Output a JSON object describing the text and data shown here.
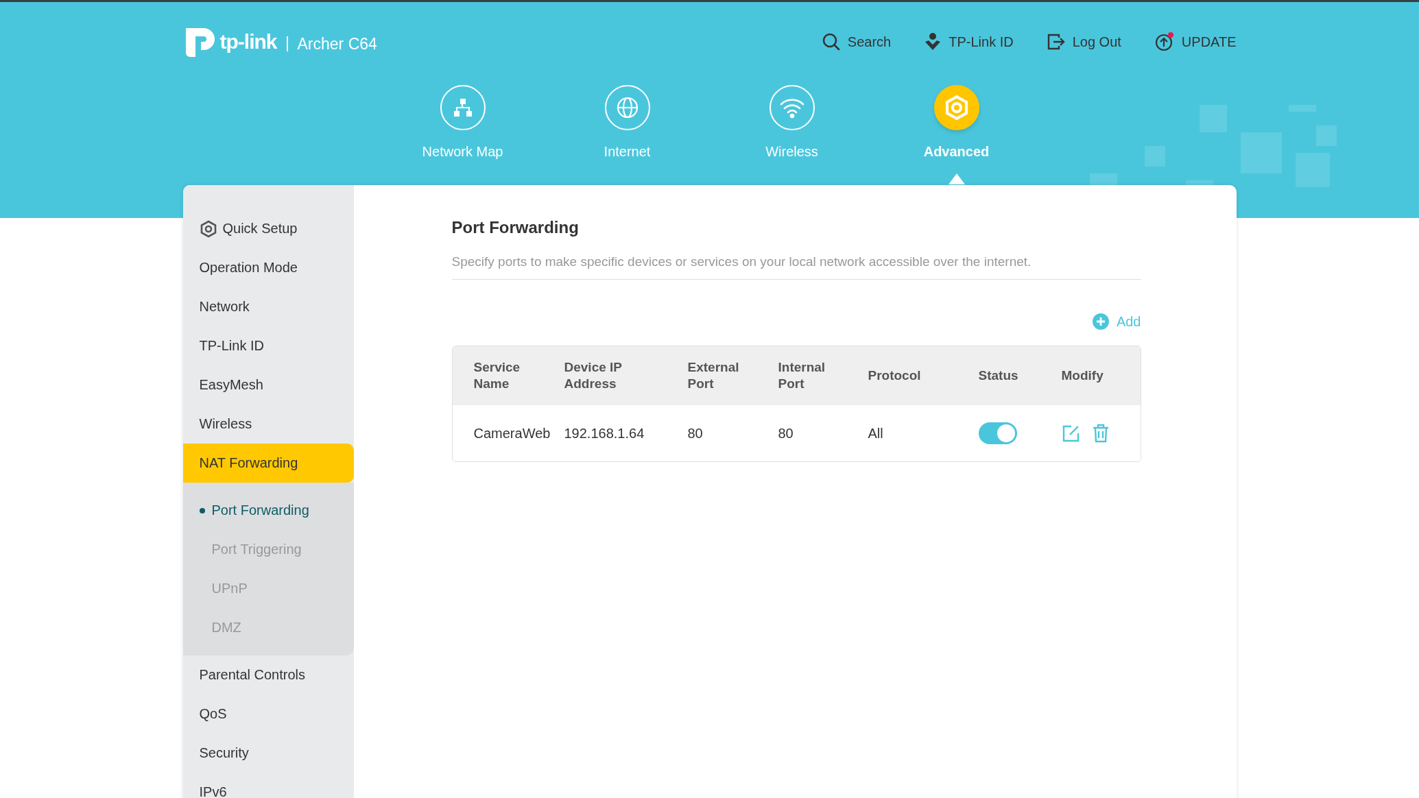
{
  "header": {
    "brand": "tp-link",
    "model": "Archer C64",
    "links": [
      {
        "kind": "search",
        "label": "Search"
      },
      {
        "kind": "id",
        "label": "TP-Link ID"
      },
      {
        "kind": "logout",
        "label": "Log Out"
      },
      {
        "kind": "update",
        "label": "UPDATE",
        "badge": true
      }
    ]
  },
  "nav": [
    {
      "kind": "map",
      "label": "Network Map",
      "selected": false
    },
    {
      "kind": "internet",
      "label": "Internet",
      "selected": false
    },
    {
      "kind": "wireless",
      "label": "Wireless",
      "selected": false
    },
    {
      "kind": "advanced",
      "label": "Advanced",
      "selected": true
    }
  ],
  "sidebar": {
    "items": [
      {
        "label": "Quick Setup",
        "icon": true,
        "selected": false
      },
      {
        "label": "Operation Mode",
        "selected": false
      },
      {
        "label": "Network",
        "selected": false
      },
      {
        "label": "TP-Link ID",
        "selected": false
      },
      {
        "label": "EasyMesh",
        "selected": false
      },
      {
        "label": "Wireless",
        "selected": false
      },
      {
        "label": "NAT Forwarding",
        "selected": true,
        "expanded": true,
        "children": [
          {
            "label": "Port Forwarding",
            "selected": true
          },
          {
            "label": "Port Triggering",
            "selected": false
          },
          {
            "label": "UPnP",
            "selected": false
          },
          {
            "label": "DMZ",
            "selected": false
          }
        ]
      },
      {
        "label": "Parental Controls",
        "selected": false
      },
      {
        "label": "QoS",
        "selected": false
      },
      {
        "label": "Security",
        "selected": false
      },
      {
        "label": "IPv6",
        "selected": false
      }
    ]
  },
  "content": {
    "title": "Port Forwarding",
    "description": "Specify ports to make specific devices or services on your local network accessible over the internet.",
    "add_label": "Add",
    "table": {
      "columns": [
        "Service Name",
        "Device IP Address",
        "External Port",
        "Internal Port",
        "Protocol",
        "Status",
        "Modify"
      ],
      "rows": [
        {
          "service_name": "CameraWeb",
          "device_ip": "192.168.1.64",
          "external_port": "80",
          "internal_port": "80",
          "protocol": "All",
          "status_on": true
        }
      ]
    }
  }
}
